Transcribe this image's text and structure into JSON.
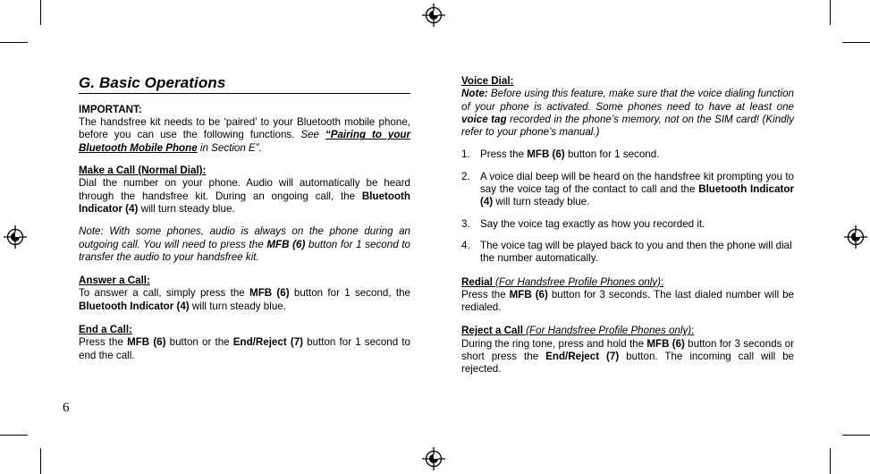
{
  "page": {
    "number": "6"
  },
  "section": {
    "title": "G. Basic Operations"
  },
  "left_column": {
    "important": {
      "heading": "IMPORTANT:",
      "text_1": "The handsfree kit needs to be ‘paired’ to your Bluetooth mobile phone, before you can use the following functions. ",
      "see": "See",
      "link_text": "“Pairing to your Bluetooth Mobile Phone",
      "text_2": " in Section E”."
    },
    "make_a_call": {
      "heading": "Make a Call (Normal Dial):",
      "text_1": "Dial the number on your phone. Audio will automatically be heard through the handsfree kit. During an ongoing call, the ",
      "bold_1": "Bluetooth Indicator (4)",
      "text_2": " will turn steady blue.",
      "note_1": "Note: With some phones, audio is always on the phone during an outgoing call. You will need to press the ",
      "note_bold": "MFB (6)",
      "note_2": " button for 1 second to transfer the audio to your handsfree kit."
    },
    "answer_a_call": {
      "heading": "Answer a Call:",
      "text_1": "To answer a call, simply press the ",
      "bold_1": "MFB (6)",
      "text_2": " button for 1 second, the ",
      "bold_2": "Bluetooth Indicator (4)",
      "text_3": " will turn steady blue."
    },
    "end_a_call": {
      "heading": "End a Call:",
      "text_1": "Press the ",
      "bold_1": "MFB (6)",
      "text_2": " button or the ",
      "bold_2": "End/Reject (7)",
      "text_3": " button for 1 second to end the call."
    }
  },
  "right_column": {
    "voice_dial": {
      "heading": "Voice Dial:",
      "note_label": "Note:",
      "note_1": " Before using this feature, make sure that the voice dialing function of your phone is activated. Some phones need to have at least one ",
      "note_bold": "voice tag",
      "note_2": " recorded in the phone’s memory, not on the SIM card! (Kindly refer to your phone’s manual.)",
      "steps": [
        {
          "num": "1.",
          "text_1": "Press the ",
          "bold_1": "MFB (6)",
          "text_2": " button for 1 second."
        },
        {
          "num": "2.",
          "text_1": "A voice dial beep will be heard on the handsfree kit prompting you to say the voice tag of the contact to call and the ",
          "bold_1": "Bluetooth Indicator (4)",
          "text_2": " will turn steady blue."
        },
        {
          "num": "3.",
          "text_1": "Say the voice tag exactly as how you recorded it.",
          "bold_1": "",
          "text_2": ""
        },
        {
          "num": "4.",
          "text_1": "The voice tag will be played back to you and then the phone will dial the number automatically.",
          "bold_1": "",
          "text_2": ""
        }
      ]
    },
    "redial": {
      "heading_bold": "Redial",
      "heading_italic": " (For Handsfree Profile Phones only)",
      "heading_colon": ":",
      "text_1": "Press the ",
      "bold_1": "MFB (6)",
      "text_2": " button for 3 seconds. The last dialed number will be redialed."
    },
    "reject_a_call": {
      "heading_bold": "Reject a Call",
      "heading_italic": " (For Handsfree Profile Phones only)",
      "heading_colon": ":",
      "text_1": "During the ring tone, press and hold the ",
      "bold_1": "MFB (6)",
      "text_2": " button for 3 seconds or short press the ",
      "bold_2": "End/Reject (7)",
      "text_3": " button. The incoming call will be rejected."
    }
  }
}
